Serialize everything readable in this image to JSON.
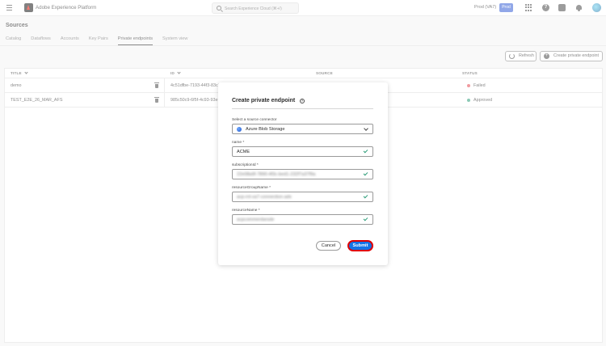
{
  "header": {
    "app_title": "Adobe Experience Platform",
    "search_placeholder": "Search Experience Cloud (⌘+/)",
    "environment": "Prod (VA7)",
    "environment_badge": "Prod"
  },
  "page": {
    "title": "Sources",
    "tabs": [
      {
        "label": "Catalog"
      },
      {
        "label": "Dataflows"
      },
      {
        "label": "Accounts"
      },
      {
        "label": "Key Pairs"
      },
      {
        "label": "Private endpoints",
        "active": true
      },
      {
        "label": "System view"
      }
    ],
    "refresh_label": "Refresh",
    "create_label": "Create private endpoint"
  },
  "table": {
    "columns": [
      "TITLE",
      "ID",
      "SOURCE",
      "STATUS"
    ],
    "rows": [
      {
        "title": "demo",
        "id": "4c51dfbe-7193-44f3-83c2",
        "status": "Failed",
        "status_color": "#e34850"
      },
      {
        "title": "TEST_E2E_26_MAR_AFS",
        "id": "985c50c9-6f5f-4c93-93e",
        "status": "Approved",
        "status_color": "#2d9d78"
      }
    ]
  },
  "modal": {
    "title": "Create private endpoint",
    "connector_label": "Select a source connector",
    "connector_value": "Azure Blob Storage",
    "fields": [
      {
        "label": "name *",
        "value": "ACME"
      },
      {
        "label": "subscriptionId *",
        "value": "22e08a9f-7890-4f3c-bed1-232f7a37f9a"
      },
      {
        "label": "resourceGroupName *",
        "value": "acp-rnl-va7-connection-adx"
      },
      {
        "label": "resourceName *",
        "value": "acpcommerdarsde"
      }
    ],
    "cancel_label": "Cancel",
    "submit_label": "Submit"
  },
  "colors": {
    "accent": "#1473e6",
    "submit_outline": "#e00000",
    "valid_check": "#2d9d78"
  }
}
